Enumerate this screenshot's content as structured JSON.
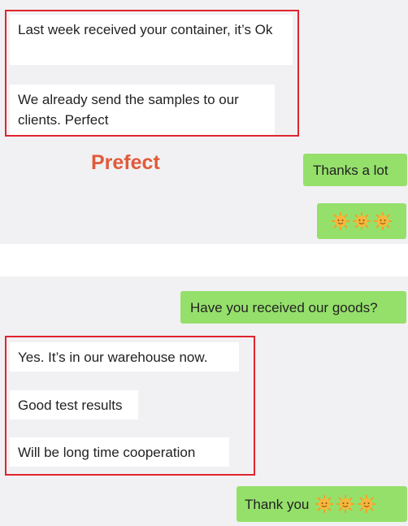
{
  "top_panel": {
    "incoming": [
      "Last week received your container, it’s Ok",
      "We already send the samples to our clients. Perfect"
    ],
    "caption": "Prefect",
    "outgoing": [
      {
        "text": "Thanks a lot",
        "emoji": []
      },
      {
        "text": "",
        "emoji": [
          "sun-emoji",
          "sun-emoji",
          "sun-emoji"
        ]
      }
    ]
  },
  "bottom_panel": {
    "outgoing_question": "Have you received our goods?",
    "incoming": [
      "Yes. It’s in our warehouse now.",
      "Good test results",
      "Will be long time cooperation"
    ],
    "outgoing_thanks": {
      "text": "Thank you",
      "emoji": [
        "sun-emoji",
        "sun-emoji",
        "sun-emoji"
      ]
    }
  },
  "colors": {
    "incoming_bubble": "#ffffff",
    "outgoing_bubble": "#95e06b",
    "highlight_border": "#e0242f",
    "caption_text": "#e15a3a",
    "panel_background": "#f1f1f3"
  }
}
